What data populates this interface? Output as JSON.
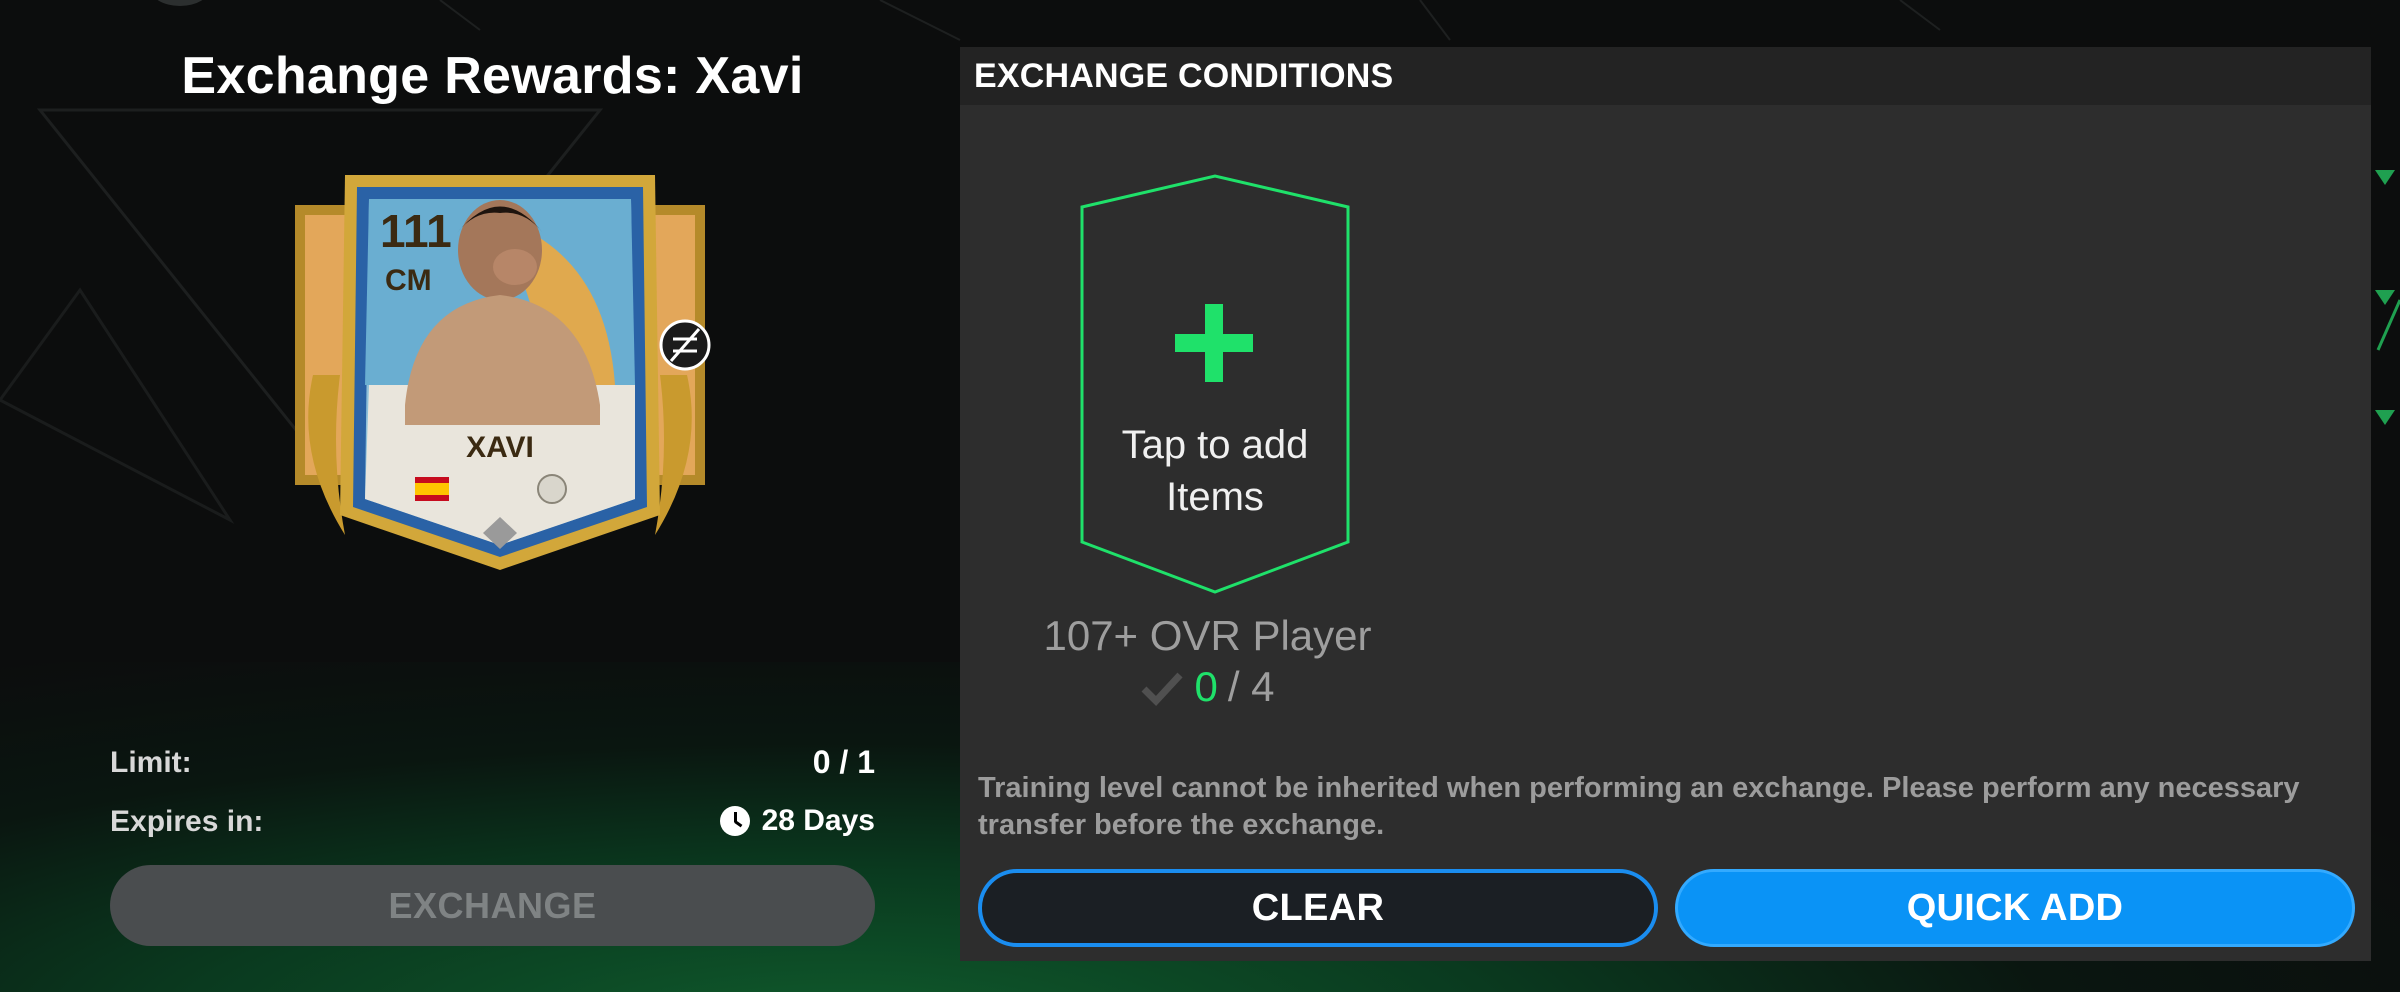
{
  "colors": {
    "accent_green": "#1fe16a",
    "accent_blue": "#0a93f6",
    "panel_bg": "#2d2d2d",
    "disabled_button": "#4a4d4f"
  },
  "reward": {
    "title": "Exchange Rewards:  Xavi",
    "card": {
      "rating": "111",
      "position": "CM",
      "name": "XAVI",
      "nation_icon": "spain-flag-icon",
      "badge_icon": "club-badge-icon",
      "untradeable_icon": "untradeable-icon"
    },
    "limit_label": "Limit:",
    "limit_value": "0 / 1",
    "expires_label": "Expires in:",
    "expires_value": "28 Days",
    "exchange_button": "EXCHANGE"
  },
  "conditions": {
    "header": "EXCHANGE CONDITIONS",
    "slot_text": "Tap to add Items",
    "requirement": "107+ OVR Player",
    "progress_current": "0",
    "progress_total": "/ 4",
    "notice": "Training level cannot be inherited when performing an exchange. Please perform any necessary transfer before the exchange.",
    "clear_button": "CLEAR",
    "quick_add_button": "QUICK ADD"
  }
}
